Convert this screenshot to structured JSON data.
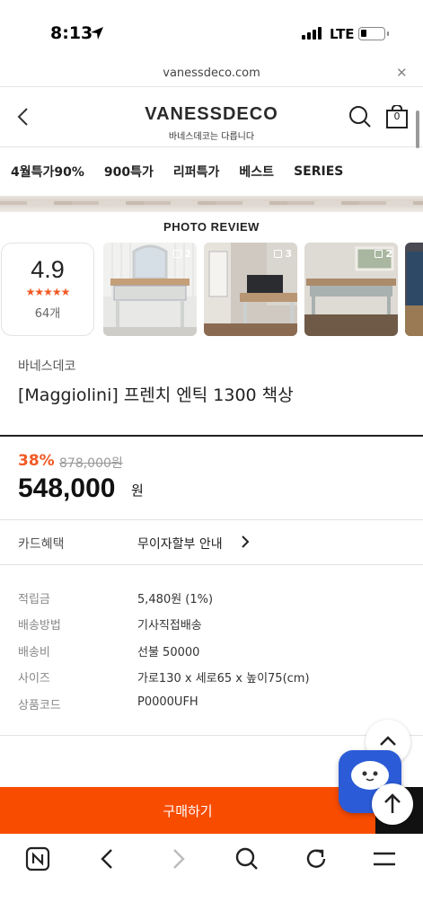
{
  "status_bar": {
    "time": "8:13",
    "network": "LTE"
  },
  "browser": {
    "url": "vanessdeco.com"
  },
  "header": {
    "logo": "VANESSDECO",
    "logo_sub": "바네스데코는 다릅니다",
    "cart_count": "0"
  },
  "categories": [
    "4월특가90%",
    "900특가",
    "리퍼특가",
    "베스트",
    "SERIES"
  ],
  "review": {
    "title": "PHOTO REVIEW",
    "score": "4.9",
    "stars": "★★★★★",
    "count": "64개",
    "photos": [
      {
        "count": "2",
        "icon": "furniture-photo"
      },
      {
        "count": "3",
        "icon": "furniture-photo"
      },
      {
        "count": "2",
        "icon": "furniture-photo"
      }
    ]
  },
  "product": {
    "brand": "바네스데코",
    "name": "[Maggiolini] 프렌치 엔틱 1300 책상",
    "discount": "38%",
    "original_price": "878,000원",
    "price": "548,000",
    "price_unit": "원"
  },
  "card_benefit": {
    "label": "카드혜택",
    "value": "무이자할부 안내"
  },
  "info": [
    {
      "key": "적립금",
      "value": "5,480원 (1%)"
    },
    {
      "key": "배송방법",
      "value": "기사직접배송"
    },
    {
      "key": "배송비",
      "value": "선불 50000"
    },
    {
      "key": "사이즈",
      "value": "가로130 x 세로65 x 높이75(cm)"
    },
    {
      "key": "상품코드",
      "value": "P0000UFH"
    }
  ],
  "buy_button": {
    "label": "구매하기"
  },
  "colors": {
    "accent": "#f84c00",
    "discount": "#f15a24",
    "chat": "#2b5bd6"
  }
}
